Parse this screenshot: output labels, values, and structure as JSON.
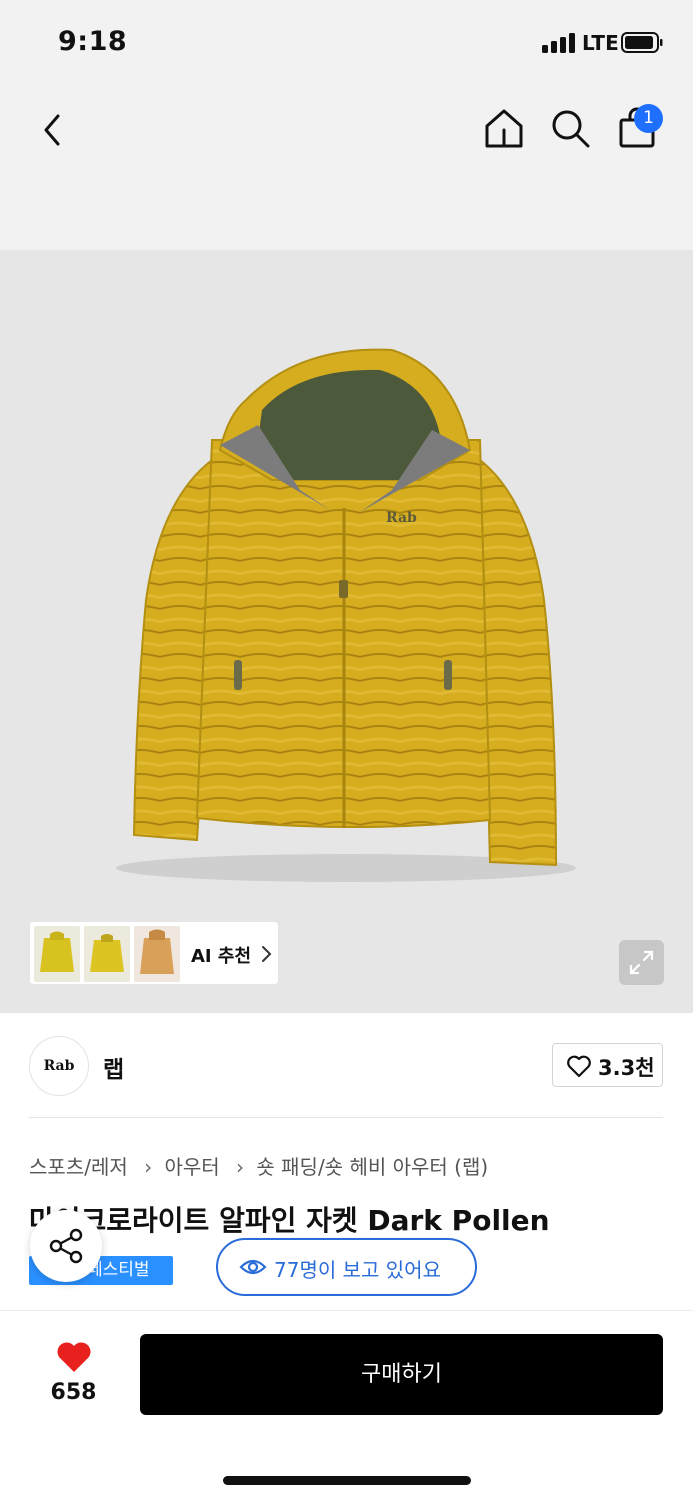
{
  "status_bar": {
    "time": "9:18",
    "network": "LTE"
  },
  "header": {
    "cart_count": "1"
  },
  "hero": {
    "ai_label": "AI 추천",
    "product_logo_text": "Rab"
  },
  "brand": {
    "logo_text": "Rab",
    "name": "랩",
    "like_count": "3.3천"
  },
  "breadcrumb": [
    "스포츠/레저",
    "아우터",
    "숏 패딩/숏 헤비 아우터 (랩)"
  ],
  "product": {
    "title": "마이크로라이트 알파인 자켓 Dark Pollen",
    "event_badge": "페스티벌",
    "viewers": "77명이 보고 있어요"
  },
  "bottom": {
    "heart_count": "658",
    "buy_label": "구매하기"
  },
  "colors": {
    "accent_blue": "#2a6cd8",
    "badge_blue": "#2a90ff",
    "heart_red": "#e8211e",
    "cart_badge": "#1f6fff",
    "jacket": "#d6ad1f"
  },
  "icons": [
    "back-icon",
    "home-icon",
    "search-icon",
    "cart-icon",
    "chevron-right-icon",
    "expand-icon",
    "heart-outline-icon",
    "share-icon",
    "eye-icon",
    "heart-filled-icon"
  ]
}
